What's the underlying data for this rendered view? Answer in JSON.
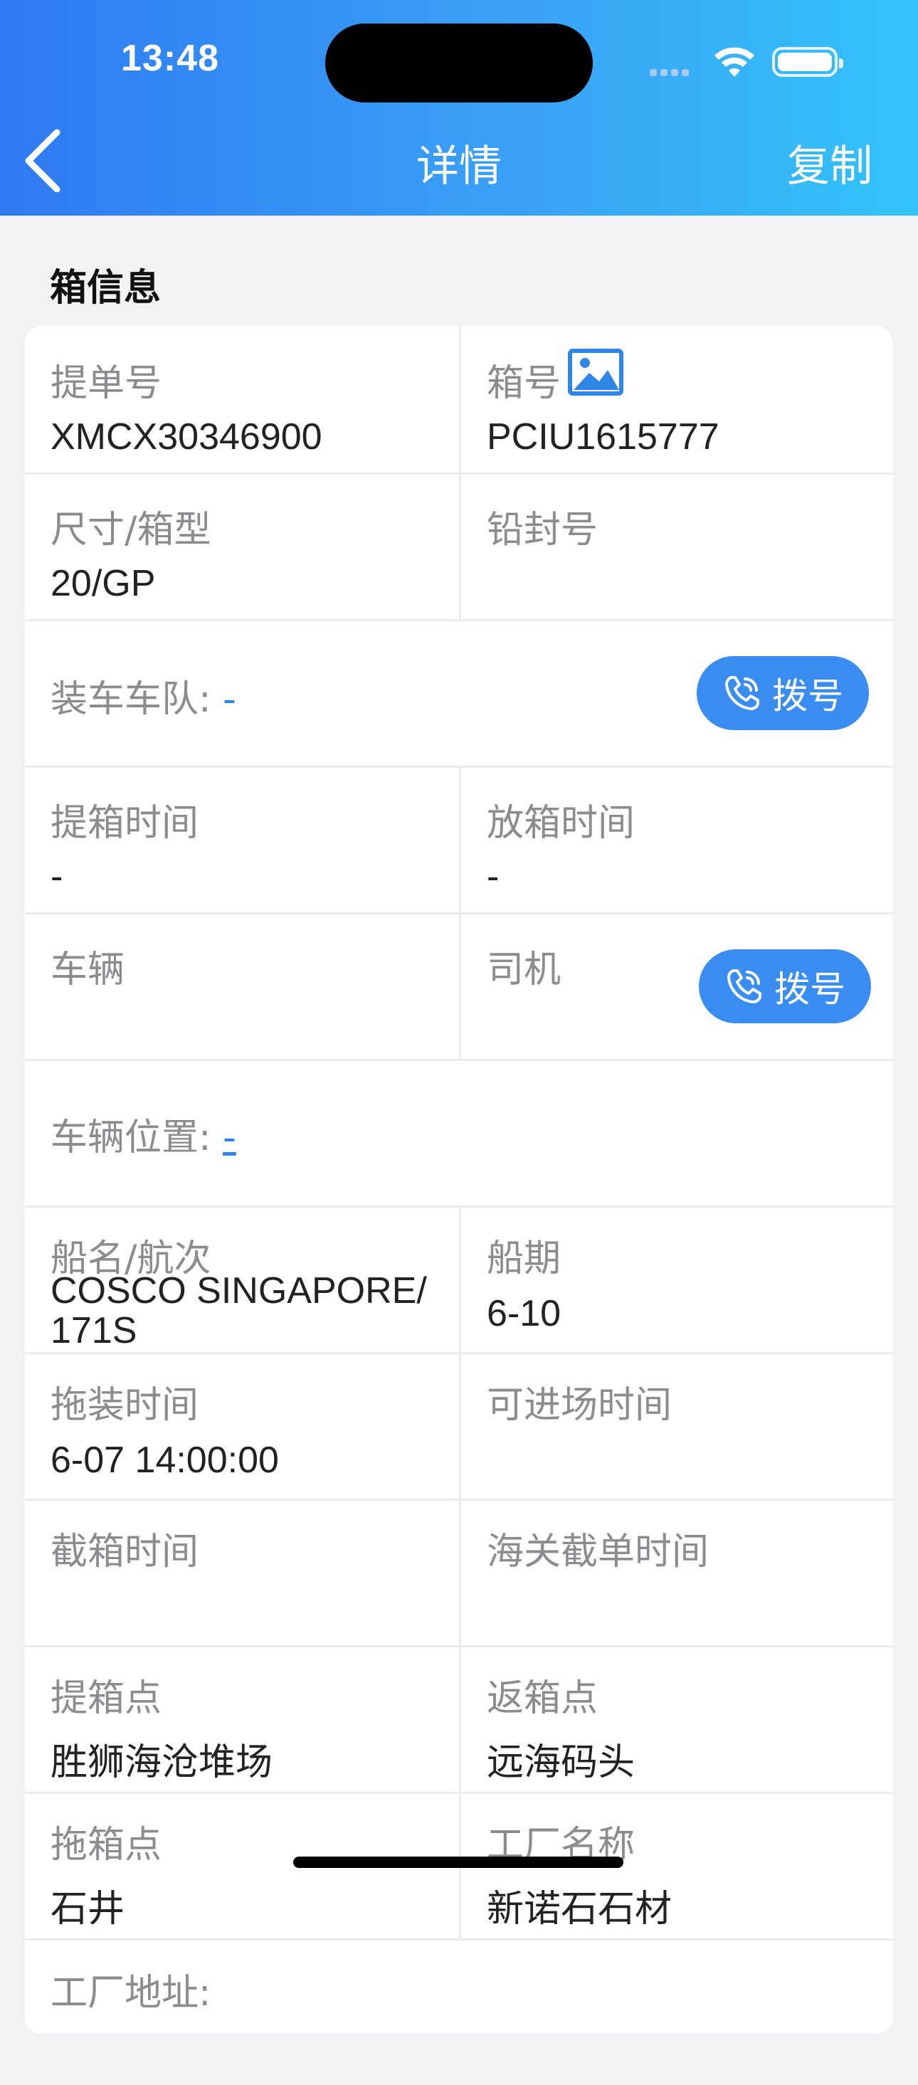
{
  "status_bar": {
    "time": "13:48"
  },
  "nav": {
    "title": "详情",
    "copy_label": "复制"
  },
  "section": {
    "title": "箱信息"
  },
  "fields": {
    "bill_no": {
      "label": "提单号",
      "value": "XMCX30346900"
    },
    "container_no": {
      "label": "箱号",
      "value": "PCIU1615777"
    },
    "size_type": {
      "label": "尺寸/箱型",
      "value": "20/GP"
    },
    "seal_no": {
      "label": "铅封号",
      "value": ""
    },
    "fleet": {
      "label": "装车车队:",
      "value": "-"
    },
    "pickup_time": {
      "label": "提箱时间",
      "value": "-"
    },
    "return_time": {
      "label": "放箱时间",
      "value": "-"
    },
    "vehicle": {
      "label": "车辆",
      "value": ""
    },
    "driver": {
      "label": "司机",
      "value": ""
    },
    "vehicle_location": {
      "label": "车辆位置:",
      "value": "-"
    },
    "vessel_voyage": {
      "label": "船名/航次",
      "value": "COSCO SINGAPORE/ 171S"
    },
    "sailing_date": {
      "label": "船期",
      "value": "6-10"
    },
    "drag_time": {
      "label": "拖装时间",
      "value": "6-07 14:00:00"
    },
    "entry_time": {
      "label": "可进场时间",
      "value": ""
    },
    "cutoff_time": {
      "label": "截箱时间",
      "value": ""
    },
    "customs_cutoff": {
      "label": "海关截单时间",
      "value": ""
    },
    "pickup_point": {
      "label": "提箱点",
      "value": "胜狮海沧堆场"
    },
    "return_point": {
      "label": "返箱点",
      "value": "远海码头"
    },
    "drag_point": {
      "label": "拖箱点",
      "value": "石井"
    },
    "factory_name": {
      "label": "工厂名称",
      "value": "新诺石石材"
    },
    "factory_address": {
      "label": "工厂地址:"
    }
  },
  "buttons": {
    "dial_label": "拨号"
  },
  "colors": {
    "accent": "#3a8df0",
    "header_start": "#2f7af2",
    "header_end": "#33c3f8"
  }
}
